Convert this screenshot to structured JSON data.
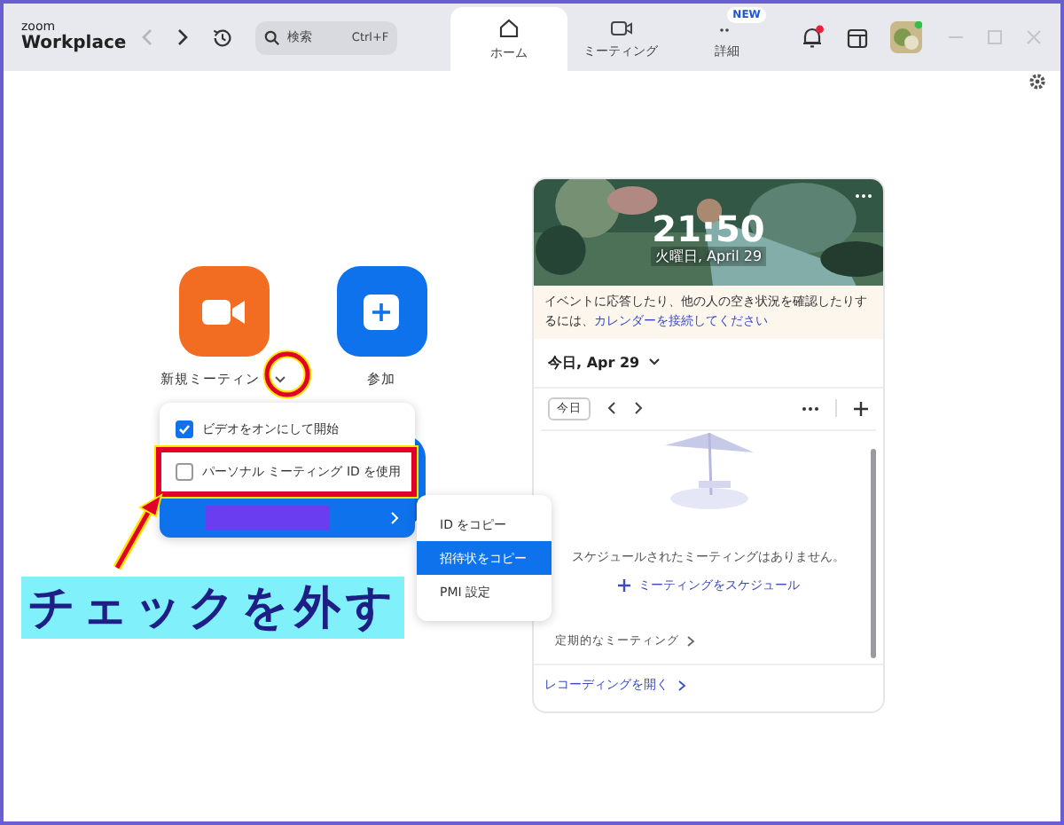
{
  "window": {
    "logo_top": "zoom",
    "logo_bottom": "Workplace"
  },
  "search": {
    "placeholder": "検索",
    "shortcut": "Ctrl+F"
  },
  "tabs": [
    {
      "label": "ホーム",
      "selected": true,
      "kind": "home"
    },
    {
      "label": "ミーティング",
      "selected": false,
      "kind": "meeting"
    },
    {
      "label": "詳細",
      "selected": false,
      "kind": "more",
      "badge": "NEW"
    }
  ],
  "actions": [
    {
      "label": "新規ミーティン",
      "kind": "video"
    },
    {
      "label": "参加",
      "kind": "join"
    }
  ],
  "menu": [
    {
      "label": "ビデオをオンにして開始",
      "kind": "checkbox",
      "checked": true
    },
    {
      "label": "パーソナル ミーティング ID を使用",
      "kind": "checkbox",
      "checked": false
    },
    {
      "kind": "submenu",
      "selected": true
    }
  ],
  "submenu": [
    {
      "label": "ID をコピー",
      "selected": false
    },
    {
      "label": "招待状をコピー",
      "selected": true
    },
    {
      "label": "PMI 設定",
      "selected": false
    }
  ],
  "annotation": {
    "text": "チェックを外す"
  },
  "calendar": {
    "time": "21:50",
    "date": "火曜日, April 29",
    "notice": "イベントに応答したり、他の人の空き状況を確認したりするには、",
    "notice_link": "カレンダーを接続してください",
    "day": "今日, Apr 29",
    "today_button": "今日",
    "empty": "スケジュールされたミーティングはありません。",
    "schedule_link": "ミーティングをスケジュール",
    "recurring": "定期的なミーティング",
    "recordings": "レコーディングを開く"
  }
}
